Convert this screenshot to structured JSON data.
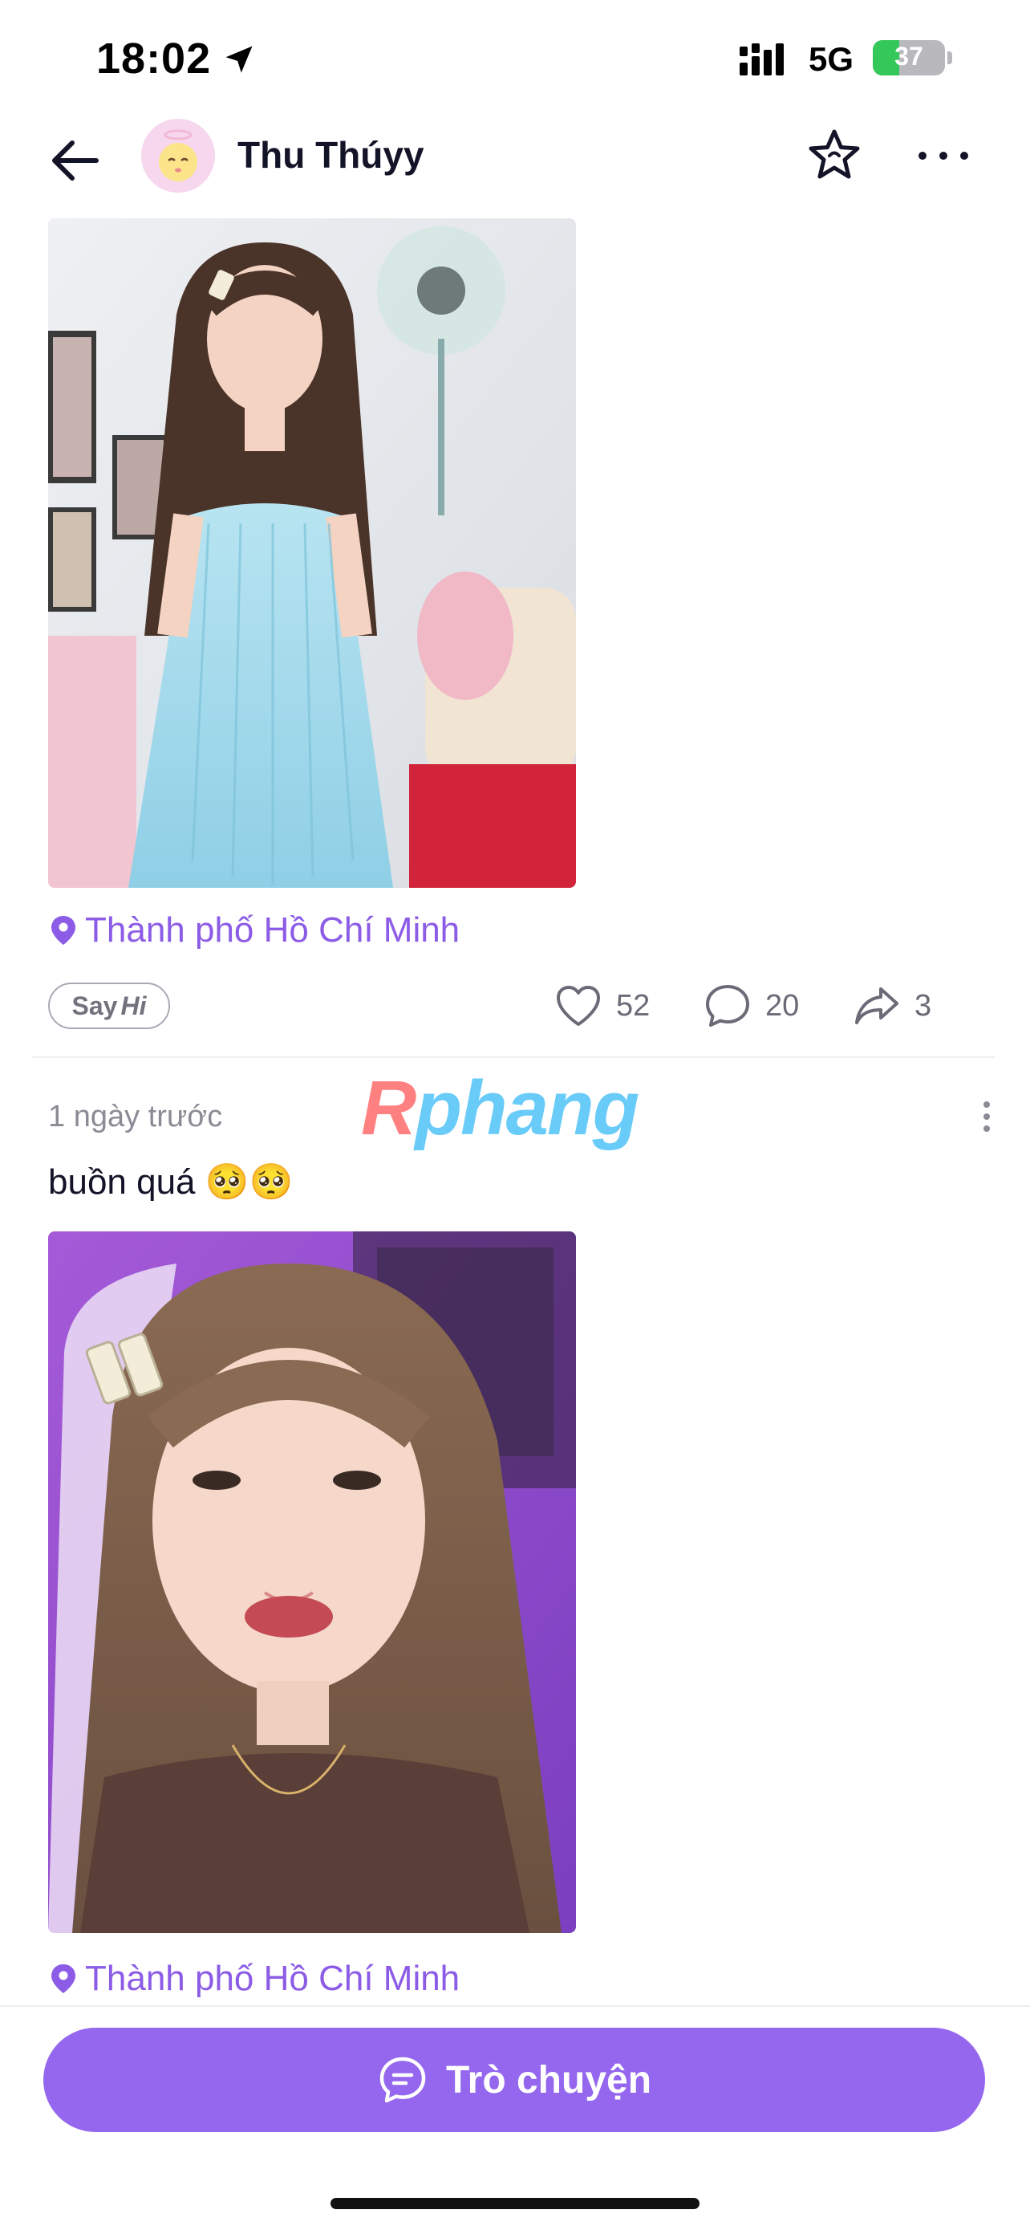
{
  "status_bar": {
    "time": "18:02",
    "network": "5G",
    "battery": "37",
    "battery_level": 0.37
  },
  "header": {
    "title": "Thu Thúyy"
  },
  "posts": [
    {
      "location": "Thành phố Hồ Chí Minh",
      "say_hi_prefix": "Say",
      "say_hi_suffix": "Hi",
      "likes": "52",
      "comments": "20",
      "shares": "3"
    },
    {
      "time": "1 ngày trước",
      "watermark_left": "R",
      "watermark_right": "phang",
      "caption": "buồn quá 🥺🥺",
      "location": "Thành phố Hồ Chí Minh"
    }
  ],
  "chat_button": {
    "label": "Trò chuyện"
  },
  "icons": {
    "back": "arrow-left-icon",
    "favorite": "star-icon",
    "more": "more-horizontal-icon",
    "location": "map-pin-icon",
    "like": "heart-icon",
    "comment": "comment-bubble-icon",
    "share": "share-arrow-icon",
    "chat": "chat-bubble-icon"
  },
  "colors": {
    "accent": "#9467ee",
    "location": "#8c5ce6",
    "battery": "#34c759"
  }
}
